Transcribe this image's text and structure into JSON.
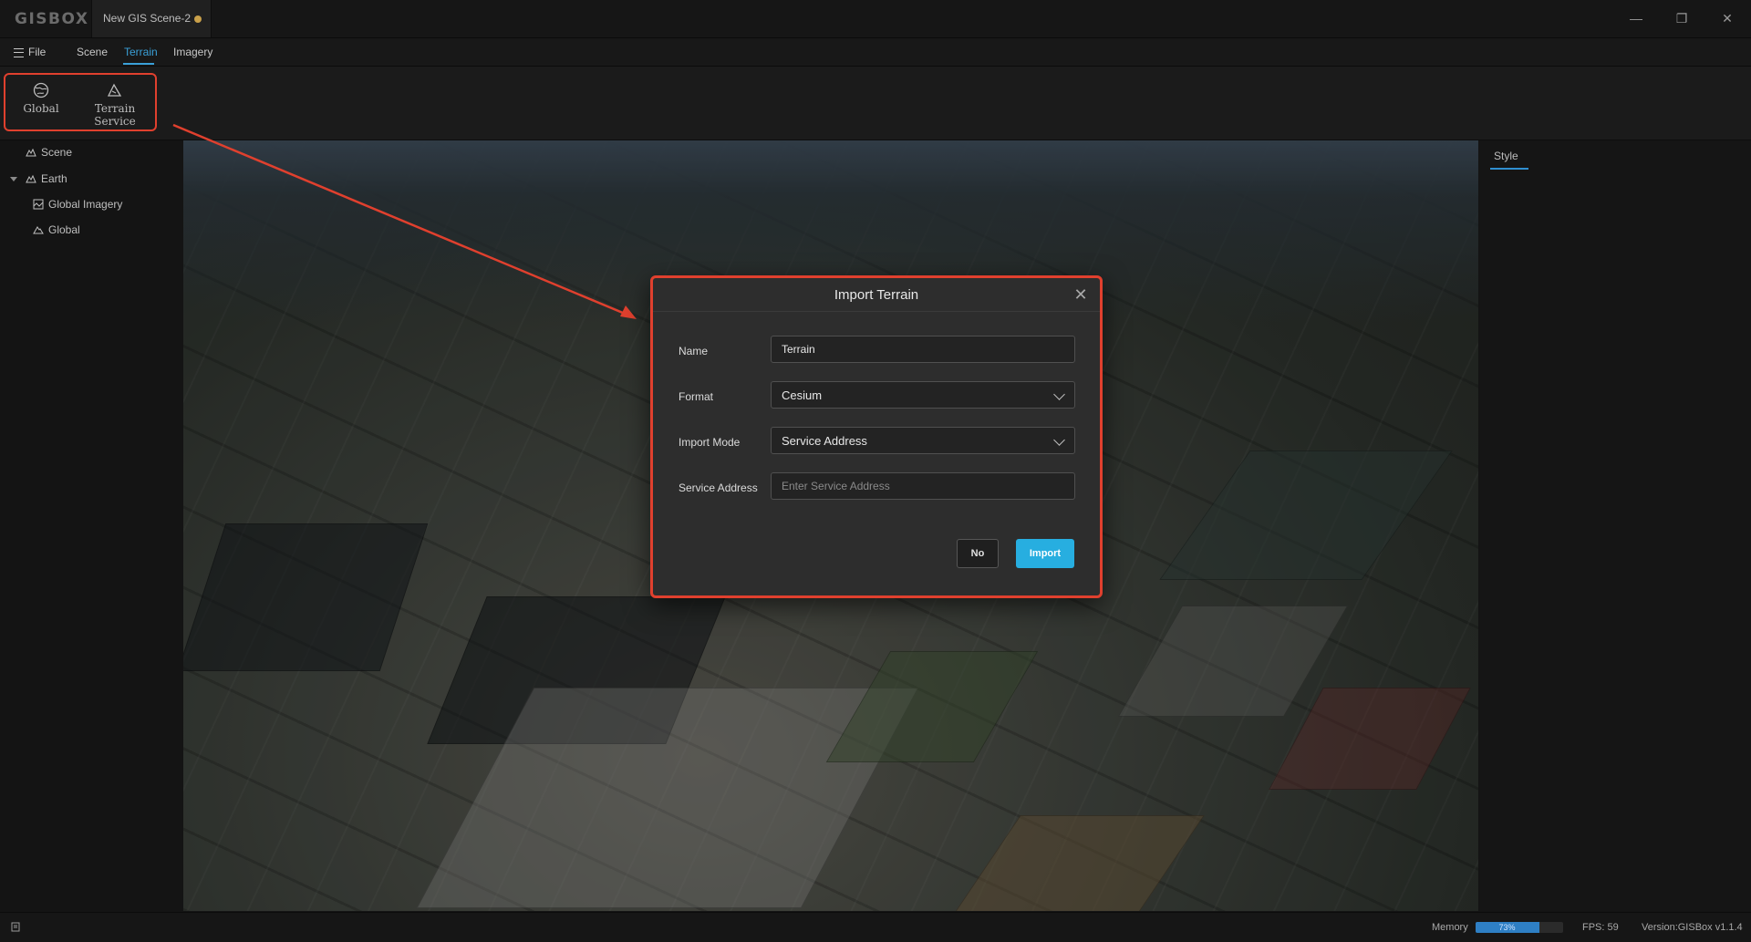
{
  "app": {
    "logo": "GISBOX",
    "doc_tab": "New GIS Scene-2"
  },
  "window": {
    "minimize_glyph": "—",
    "restore_glyph": "❐",
    "close_glyph": "✕"
  },
  "menu": {
    "file": "File",
    "scene": "Scene",
    "terrain": "Terrain",
    "imagery": "Imagery",
    "active": "Terrain"
  },
  "ribbon": {
    "global": "Global",
    "terrain_service": "Terrain Service"
  },
  "tree": {
    "items": [
      {
        "label": "Scene",
        "icon": "mountain-icon"
      },
      {
        "label": "Earth",
        "icon": "mountain-icon"
      },
      {
        "label": "Global Imagery",
        "icon": "imagery-icon"
      },
      {
        "label": "Global",
        "icon": "terrain-icon"
      }
    ]
  },
  "right_panel": {
    "tab": "Style"
  },
  "dialog": {
    "title": "Import Terrain",
    "close_glyph": "✕",
    "fields": {
      "name_label": "Name",
      "name_value": "Terrain",
      "format_label": "Format",
      "format_value": "Cesium",
      "import_mode_label": "Import Mode",
      "import_mode_value": "Service Address",
      "service_address_label": "Service Address",
      "service_address_placeholder": "Enter Service Address",
      "service_address_value": ""
    },
    "no_label": "No",
    "import_label": "Import"
  },
  "status": {
    "memory_label": "Memory",
    "memory_percent": "73%",
    "memory_fraction": 0.73,
    "fps": "FPS: 59",
    "version": "Version:GISBox v1.1.4"
  },
  "colors": {
    "accent": "#3aa0d8",
    "highlight": "#e0402e",
    "import_button": "#27aee0"
  }
}
